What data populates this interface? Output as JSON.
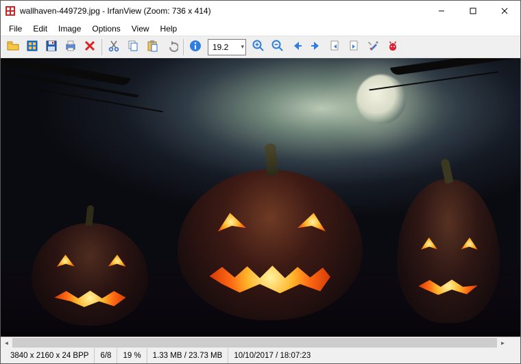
{
  "titlebar": {
    "title": "wallhaven-449729.jpg - IrfanView (Zoom: 736 x 414)"
  },
  "menu": {
    "items": [
      "File",
      "Edit",
      "Image",
      "Options",
      "View",
      "Help"
    ]
  },
  "toolbar": {
    "zoom_value": "19.2",
    "icons": {
      "open": "open-folder-icon",
      "slideshow": "slideshow-icon",
      "save": "save-icon",
      "print": "print-icon",
      "delete": "delete-icon",
      "cut": "cut-icon",
      "copy": "copy-icon",
      "paste": "paste-icon",
      "undo": "undo-icon",
      "info": "info-icon",
      "zoom_in": "zoom-in-icon",
      "zoom_out": "zoom-out-icon",
      "prev": "previous-icon",
      "next": "next-icon",
      "first": "first-file-icon",
      "last": "last-file-icon",
      "settings": "settings-icon",
      "about": "about-cat-icon"
    }
  },
  "status": {
    "dimensions": "3840 x 2160 x 24 BPP",
    "index": "6/8",
    "zoom_pct": "19 %",
    "size": "1.33 MB / 23.73 MB",
    "datetime": "10/10/2017 / 18:07:23"
  }
}
